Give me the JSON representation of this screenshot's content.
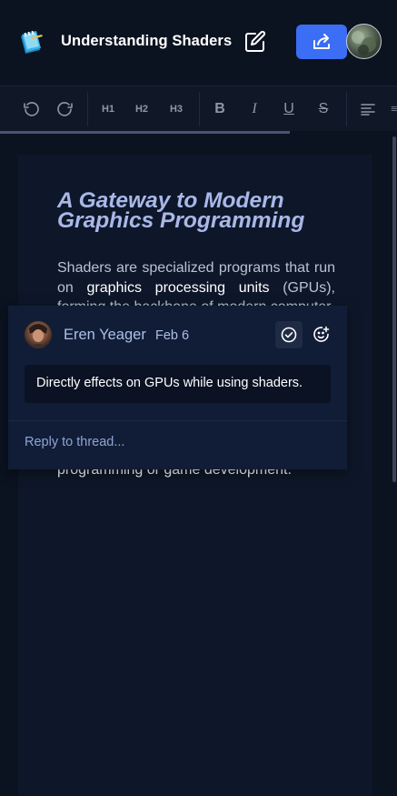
{
  "header": {
    "title": "Understanding Shaders",
    "icons": {
      "logo": "notepad-icon",
      "edit": "edit-square-icon",
      "share": "share-icon",
      "avatar": "user-avatar"
    },
    "accent_color": "#3b6df5"
  },
  "toolbar": {
    "undo": "undo-icon",
    "redo": "redo-icon",
    "h1_label": "H1",
    "h2_label": "H2",
    "h3_label": "H3",
    "bold_label": "B",
    "italic_label": "I",
    "underline_label": "U",
    "strike_label": "S",
    "align": "align-left-icon",
    "more": "more-icon"
  },
  "document": {
    "heading": "A Gateway to Modern Graphics Programming",
    "para_before": "Shaders are specialized programs that run on ",
    "para_highlight": "graphics processing units",
    "para_after": " (GPUs), forming the backbone of modern computer",
    "tail_text": "programming or game development."
  },
  "comment": {
    "author": "Eren Yeager",
    "date": "Feb 6",
    "body": "Directly effects on GPUs while using shaders.",
    "reply_placeholder": "Reply to thread...",
    "icons": {
      "resolve": "check-circle-icon",
      "react": "emoji-add-icon"
    }
  }
}
